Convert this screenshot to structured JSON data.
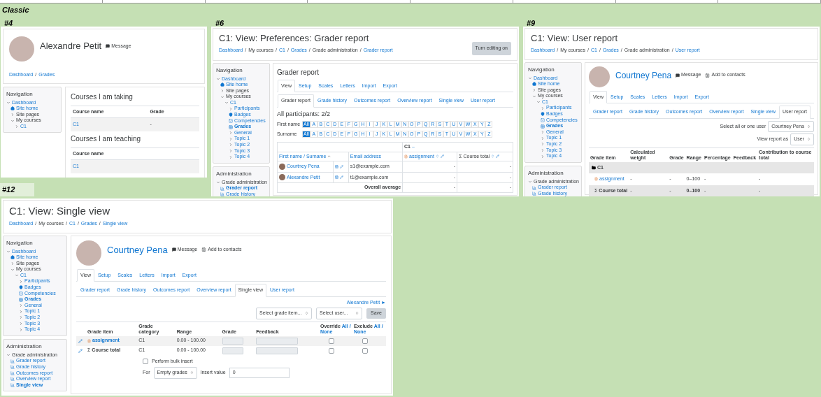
{
  "heading": "Classic",
  "panels": [
    {
      "label": "#4",
      "highlighted": false,
      "kind": "profile",
      "profile": {
        "name": "Alexandre Petit",
        "link": false,
        "actions": [
          {
            "kind": "message",
            "label": "Message"
          }
        ]
      },
      "breadcrumb": {
        "separator": "/",
        "items": [
          {
            "label": "Dashboard",
            "link": true
          },
          {
            "label": "Grades",
            "link": true
          }
        ]
      },
      "blocks": [
        {
          "title": "Navigation",
          "items": [
            {
              "label": "Dashboard",
              "kind": "node",
              "expanded": true,
              "link": true,
              "selected": false,
              "children": [
                {
                  "label": "Site home",
                  "kind": "home",
                  "link": true,
                  "selected": false
                },
                {
                  "label": "Site pages",
                  "kind": "node",
                  "expanded": false,
                  "link": false,
                  "selected": false
                },
                {
                  "label": "My courses",
                  "kind": "node",
                  "expanded": true,
                  "link": false,
                  "selected": false,
                  "children": [
                    {
                      "label": "C1",
                      "kind": "node",
                      "expanded": false,
                      "link": true,
                      "selected": false
                    }
                  ]
                }
              ]
            }
          ]
        }
      ],
      "courses": [
        {
          "title": "Courses I am taking",
          "columns": [
            "Course name",
            "Grade"
          ],
          "rows": [
            [
              "C1",
              "-"
            ]
          ]
        },
        {
          "title": "Courses I am teaching",
          "columns": [
            "Course name"
          ],
          "rows": [
            [
              "C1"
            ]
          ]
        }
      ]
    },
    {
      "label": "#6",
      "highlighted": false,
      "kind": "grader",
      "header": {
        "title": "C1: View: Preferences: Grader report",
        "button": "Turn editing on",
        "breadcrumb": {
          "separator": "/",
          "items": [
            {
              "label": "Dashboard",
              "link": true
            },
            {
              "label": "My courses",
              "link": false
            },
            {
              "label": "C1",
              "link": true
            },
            {
              "label": "Grades",
              "link": true
            },
            {
              "label": "Grade administration",
              "link": false
            },
            {
              "label": "Grader report",
              "link": true
            }
          ]
        }
      },
      "blocks": [
        {
          "title": "Navigation",
          "items": [
            {
              "label": "Dashboard",
              "kind": "node",
              "expanded": true,
              "link": true,
              "selected": false,
              "children": [
                {
                  "label": "Site home",
                  "kind": "home",
                  "link": true,
                  "selected": false
                },
                {
                  "label": "Site pages",
                  "kind": "node",
                  "expanded": false,
                  "link": false,
                  "selected": false
                },
                {
                  "label": "My courses",
                  "kind": "node",
                  "expanded": true,
                  "link": false,
                  "selected": false,
                  "children": [
                    {
                      "label": "C1",
                      "kind": "node",
                      "expanded": true,
                      "link": true,
                      "selected": false,
                      "children": [
                        {
                          "label": "Participants",
                          "kind": "node",
                          "expanded": false,
                          "link": true,
                          "selected": false
                        },
                        {
                          "label": "Badges",
                          "kind": "badge",
                          "link": true,
                          "selected": false
                        },
                        {
                          "label": "Competencies",
                          "kind": "competency",
                          "link": true,
                          "selected": false
                        },
                        {
                          "label": "Grades",
                          "kind": "grades",
                          "link": true,
                          "selected": true
                        },
                        {
                          "label": "General",
                          "kind": "node",
                          "expanded": false,
                          "link": true,
                          "selected": false
                        },
                        {
                          "label": "Topic 1",
                          "kind": "node",
                          "expanded": false,
                          "link": true,
                          "selected": false
                        },
                        {
                          "label": "Topic 2",
                          "kind": "node",
                          "expanded": false,
                          "link": true,
                          "selected": false
                        },
                        {
                          "label": "Topic 3",
                          "kind": "node",
                          "expanded": false,
                          "link": true,
                          "selected": false
                        },
                        {
                          "label": "Topic 4",
                          "kind": "node",
                          "expanded": false,
                          "link": true,
                          "selected": false
                        }
                      ]
                    }
                  ]
                }
              ]
            }
          ]
        },
        {
          "title": "Administration",
          "items": [
            {
              "label": "Grade administration",
              "kind": "node",
              "expanded": true,
              "link": false,
              "selected": false,
              "children": [
                {
                  "label": "Grader report",
                  "kind": "report",
                  "link": true,
                  "selected": true
                },
                {
                  "label": "Grade history",
                  "kind": "report",
                  "link": true,
                  "selected": false
                }
              ]
            }
          ]
        }
      ],
      "main": {
        "heading": "Grader report",
        "tabs": [
          {
            "label": "View",
            "selected": true
          },
          {
            "label": "Setup",
            "selected": false
          },
          {
            "label": "Scales",
            "selected": false
          },
          {
            "label": "Letters",
            "selected": false
          },
          {
            "label": "Import",
            "selected": false
          },
          {
            "label": "Export",
            "selected": false
          }
        ],
        "subtabs": [
          {
            "label": "Grader report",
            "selected": true
          },
          {
            "label": "Grade history",
            "selected": false
          },
          {
            "label": "Outcomes report",
            "selected": false
          },
          {
            "label": "Overview report",
            "selected": false
          },
          {
            "label": "Single view",
            "selected": false
          },
          {
            "label": "User report",
            "selected": false
          }
        ],
        "participants": "All participants: 2/2",
        "filters": [
          {
            "label": "First name",
            "letters": [
              {
                "label": "All",
                "selected": true
              },
              {
                "label": "A",
                "selected": false
              },
              {
                "label": "B",
                "selected": false
              },
              {
                "label": "C",
                "selected": false
              },
              {
                "label": "D",
                "selected": false
              },
              {
                "label": "E",
                "selected": false
              },
              {
                "label": "F",
                "selected": false
              },
              {
                "label": "G",
                "selected": false
              },
              {
                "label": "H",
                "selected": false
              },
              {
                "label": "I",
                "selected": false
              },
              {
                "label": "J",
                "selected": false
              },
              {
                "label": "K",
                "selected": false
              },
              {
                "label": "L",
                "selected": false
              },
              {
                "label": "M",
                "selected": false
              },
              {
                "label": "N",
                "selected": false
              },
              {
                "label": "O",
                "selected": false
              },
              {
                "label": "P",
                "selected": false
              },
              {
                "label": "Q",
                "selected": false
              },
              {
                "label": "R",
                "selected": false
              },
              {
                "label": "S",
                "selected": false
              },
              {
                "label": "T",
                "selected": false
              },
              {
                "label": "U",
                "selected": false
              },
              {
                "label": "V",
                "selected": false
              },
              {
                "label": "W",
                "selected": false
              },
              {
                "label": "X",
                "selected": false
              },
              {
                "label": "Y",
                "selected": false
              },
              {
                "label": "Z",
                "selected": false
              }
            ]
          },
          {
            "label": "Surname",
            "letters": [
              {
                "label": "All",
                "selected": true
              },
              {
                "label": "A",
                "selected": false
              },
              {
                "label": "B",
                "selected": false
              },
              {
                "label": "C",
                "selected": false
              },
              {
                "label": "D",
                "selected": false
              },
              {
                "label": "E",
                "selected": false
              },
              {
                "label": "F",
                "selected": false
              },
              {
                "label": "G",
                "selected": false
              },
              {
                "label": "H",
                "selected": false
              },
              {
                "label": "I",
                "selected": false
              },
              {
                "label": "J",
                "selected": false
              },
              {
                "label": "K",
                "selected": false
              },
              {
                "label": "L",
                "selected": false
              },
              {
                "label": "M",
                "selected": false
              },
              {
                "label": "N",
                "selected": false
              },
              {
                "label": "O",
                "selected": false
              },
              {
                "label": "P",
                "selected": false
              },
              {
                "label": "Q",
                "selected": false
              },
              {
                "label": "R",
                "selected": false
              },
              {
                "label": "S",
                "selected": false
              },
              {
                "label": "T",
                "selected": false
              },
              {
                "label": "U",
                "selected": false
              },
              {
                "label": "V",
                "selected": false
              },
              {
                "label": "W",
                "selected": false
              },
              {
                "label": "X",
                "selected": false
              },
              {
                "label": "Y",
                "selected": false
              },
              {
                "label": "Z",
                "selected": false
              }
            ]
          }
        ],
        "table": {
          "category": "C1",
          "name_column": "First name / Surname",
          "email_column": "Email address",
          "item_column": "assignment",
          "total_column": "Course total",
          "total_symbol": "Σ",
          "rows": [
            {
              "name": "Courtney Pena",
              "email": "s1@example.com",
              "values": [
                "-",
                "-"
              ]
            },
            {
              "name": "Alexandre Petit",
              "email": "t1@example.com",
              "values": [
                "-",
                "-"
              ]
            }
          ],
          "average": {
            "label": "Overall average",
            "values": [
              "-",
              "-"
            ]
          }
        }
      }
    },
    {
      "label": "#9",
      "highlighted": false,
      "kind": "user_report",
      "header": {
        "title": "C1: View: User report",
        "breadcrumb": {
          "separator": "/",
          "items": [
            {
              "label": "Dashboard",
              "link": true
            },
            {
              "label": "My courses",
              "link": false
            },
            {
              "label": "C1",
              "link": true
            },
            {
              "label": "Grades",
              "link": true
            },
            {
              "label": "Grade administration",
              "link": false
            },
            {
              "label": "User report",
              "link": true
            }
          ]
        }
      },
      "blocks": [
        {
          "title": "Navigation",
          "items": [
            {
              "label": "Dashboard",
              "kind": "node",
              "expanded": true,
              "link": true,
              "selected": false,
              "children": [
                {
                  "label": "Site home",
                  "kind": "home",
                  "link": true,
                  "selected": false
                },
                {
                  "label": "Site pages",
                  "kind": "node",
                  "expanded": false,
                  "link": false,
                  "selected": false
                },
                {
                  "label": "My courses",
                  "kind": "node",
                  "expanded": true,
                  "link": false,
                  "selected": false,
                  "children": [
                    {
                      "label": "C1",
                      "kind": "node",
                      "expanded": true,
                      "link": true,
                      "selected": false,
                      "children": [
                        {
                          "label": "Participants",
                          "kind": "node",
                          "expanded": false,
                          "link": true,
                          "selected": false
                        },
                        {
                          "label": "Badges",
                          "kind": "badge",
                          "link": true,
                          "selected": false
                        },
                        {
                          "label": "Competencies",
                          "kind": "competency",
                          "link": true,
                          "selected": false
                        },
                        {
                          "label": "Grades",
                          "kind": "grades",
                          "link": true,
                          "selected": true
                        },
                        {
                          "label": "General",
                          "kind": "node",
                          "expanded": false,
                          "link": true,
                          "selected": false
                        },
                        {
                          "label": "Topic 1",
                          "kind": "node",
                          "expanded": false,
                          "link": true,
                          "selected": false
                        },
                        {
                          "label": "Topic 2",
                          "kind": "node",
                          "expanded": false,
                          "link": true,
                          "selected": false
                        },
                        {
                          "label": "Topic 3",
                          "kind": "node",
                          "expanded": false,
                          "link": true,
                          "selected": false
                        },
                        {
                          "label": "Topic 4",
                          "kind": "node",
                          "expanded": false,
                          "link": true,
                          "selected": false
                        }
                      ]
                    }
                  ]
                }
              ]
            }
          ]
        },
        {
          "title": "Administration",
          "items": [
            {
              "label": "Grade administration",
              "kind": "node",
              "expanded": true,
              "link": false,
              "selected": false,
              "children": [
                {
                  "label": "Grader report",
                  "kind": "report",
                  "link": true,
                  "selected": false
                },
                {
                  "label": "Grade history",
                  "kind": "report",
                  "link": true,
                  "selected": false
                }
              ]
            }
          ]
        }
      ],
      "main": {
        "profile": {
          "name": "Courtney Pena",
          "link": true,
          "actions": [
            {
              "kind": "message",
              "label": "Message"
            },
            {
              "kind": "contact",
              "label": "Add to contacts"
            }
          ]
        },
        "tabs": [
          {
            "label": "View",
            "selected": true
          },
          {
            "label": "Setup",
            "selected": false
          },
          {
            "label": "Scales",
            "selected": false
          },
          {
            "label": "Letters",
            "selected": false
          },
          {
            "label": "Import",
            "selected": false
          },
          {
            "label": "Export",
            "selected": false
          }
        ],
        "subtabs": [
          {
            "label": "Grader report",
            "selected": false
          },
          {
            "label": "Grade history",
            "selected": false
          },
          {
            "label": "Outcomes report",
            "selected": false
          },
          {
            "label": "Overview report",
            "selected": false
          },
          {
            "label": "Single view",
            "selected": false
          },
          {
            "label": "User report",
            "selected": true
          }
        ],
        "selectors": [
          {
            "label": "Select all or one user",
            "value": "Courtney Pena"
          },
          {
            "label": "View report as",
            "value": "User"
          }
        ],
        "table": {
          "columns": [
            "Grade item",
            "Calculated weight",
            "Grade",
            "Range",
            "Percentage",
            "Feedback",
            "Contribution to course total"
          ],
          "rows": [
            {
              "kind": "category",
              "item": "C1"
            },
            {
              "kind": "item",
              "item": "assignment",
              "weight": "-",
              "grade": "-",
              "range": "0–100",
              "percentage": "-",
              "contribution": "-"
            },
            {
              "kind": "total",
              "symbol": "Σ",
              "item": "Course total",
              "weight": "-",
              "grade": "-",
              "range": "0–100",
              "percentage": "-",
              "contribution": "-"
            }
          ]
        }
      }
    },
    {
      "label": "#12",
      "highlighted": true,
      "kind": "single_view",
      "header": {
        "title": "C1: View: Single view",
        "breadcrumb": {
          "separator": "/",
          "items": [
            {
              "label": "Dashboard",
              "link": true
            },
            {
              "label": "My courses",
              "link": false
            },
            {
              "label": "C1",
              "link": true
            },
            {
              "label": "Grades",
              "link": true
            },
            {
              "label": "Single view",
              "link": true
            }
          ]
        }
      },
      "blocks": [
        {
          "title": "Navigation",
          "items": [
            {
              "label": "Dashboard",
              "kind": "node",
              "expanded": true,
              "link": true,
              "selected": false,
              "children": [
                {
                  "label": "Site home",
                  "kind": "home",
                  "link": true,
                  "selected": false
                },
                {
                  "label": "Site pages",
                  "kind": "node",
                  "expanded": false,
                  "link": false,
                  "selected": false
                },
                {
                  "label": "My courses",
                  "kind": "node",
                  "expanded": true,
                  "link": false,
                  "selected": false,
                  "children": [
                    {
                      "label": "C1",
                      "kind": "node",
                      "expanded": true,
                      "link": true,
                      "selected": false,
                      "children": [
                        {
                          "label": "Participants",
                          "kind": "node",
                          "expanded": false,
                          "link": true,
                          "selected": false
                        },
                        {
                          "label": "Badges",
                          "kind": "badge",
                          "link": true,
                          "selected": false
                        },
                        {
                          "label": "Competencies",
                          "kind": "competency",
                          "link": true,
                          "selected": false
                        },
                        {
                          "label": "Grades",
                          "kind": "grades",
                          "link": true,
                          "selected": true
                        },
                        {
                          "label": "General",
                          "kind": "node",
                          "expanded": false,
                          "link": true,
                          "selected": false
                        },
                        {
                          "label": "Topic 1",
                          "kind": "node",
                          "expanded": false,
                          "link": true,
                          "selected": false
                        },
                        {
                          "label": "Topic 2",
                          "kind": "node",
                          "expanded": false,
                          "link": true,
                          "selected": false
                        },
                        {
                          "label": "Topic 3",
                          "kind": "node",
                          "expanded": false,
                          "link": true,
                          "selected": false
                        },
                        {
                          "label": "Topic 4",
                          "kind": "node",
                          "expanded": false,
                          "link": true,
                          "selected": false
                        }
                      ]
                    }
                  ]
                }
              ]
            }
          ]
        },
        {
          "title": "Administration",
          "items": [
            {
              "label": "Grade administration",
              "kind": "node",
              "expanded": true,
              "link": false,
              "selected": false,
              "children": [
                {
                  "label": "Grader report",
                  "kind": "report",
                  "link": true,
                  "selected": false
                },
                {
                  "label": "Grade history",
                  "kind": "report",
                  "link": true,
                  "selected": false
                },
                {
                  "label": "Outcomes report",
                  "kind": "report",
                  "link": true,
                  "selected": false
                },
                {
                  "label": "Overview report",
                  "kind": "report",
                  "link": true,
                  "selected": false
                },
                {
                  "label": "Single view",
                  "kind": "report",
                  "link": true,
                  "selected": true
                }
              ]
            }
          ]
        }
      ],
      "main": {
        "profile": {
          "name": "Courtney Pena",
          "link": true,
          "actions": [
            {
              "kind": "message",
              "label": "Message"
            },
            {
              "kind": "contact",
              "label": "Add to contacts"
            }
          ]
        },
        "tabs": [
          {
            "label": "View",
            "selected": true
          },
          {
            "label": "Setup",
            "selected": false
          },
          {
            "label": "Scales",
            "selected": false
          },
          {
            "label": "Letters",
            "selected": false
          },
          {
            "label": "Import",
            "selected": false
          },
          {
            "label": "Export",
            "selected": false
          }
        ],
        "subtabs": [
          {
            "label": "Grader report",
            "selected": false
          },
          {
            "label": "Grade history",
            "selected": false
          },
          {
            "label": "Outcomes report",
            "selected": false
          },
          {
            "label": "Overview report",
            "selected": false
          },
          {
            "label": "Single view",
            "selected": true
          },
          {
            "label": "User report",
            "selected": false
          }
        ],
        "next_user": "Alexandre Petit ►",
        "selectors": [
          "Select grade item...",
          "Select user..."
        ],
        "save": "Save",
        "table": {
          "columns": [
            "Grade item",
            "Grade category",
            "Range",
            "Grade",
            "Feedback"
          ],
          "toggles": [
            {
              "label": "Override",
              "all": "All",
              "separator": "/",
              "none": "None"
            },
            {
              "label": "Exclude",
              "all": "All",
              "separator": "/",
              "none": "None"
            }
          ],
          "rows": [
            {
              "kind": "item",
              "item": "assignment",
              "category": "C1",
              "range": "0.00 - 100.00",
              "override": false,
              "exclude": false
            },
            {
              "kind": "total",
              "symbol": "Σ",
              "item": "Course total",
              "category": "C1",
              "range": "0.00 - 100.00",
              "override": false,
              "exclude": false
            }
          ]
        },
        "bulk": {
          "checked": false,
          "label": "Perform bulk insert",
          "for_label": "For",
          "for_value": "Empty grades",
          "insert_label": "Insert value",
          "insert_value": "0"
        }
      }
    }
  ]
}
